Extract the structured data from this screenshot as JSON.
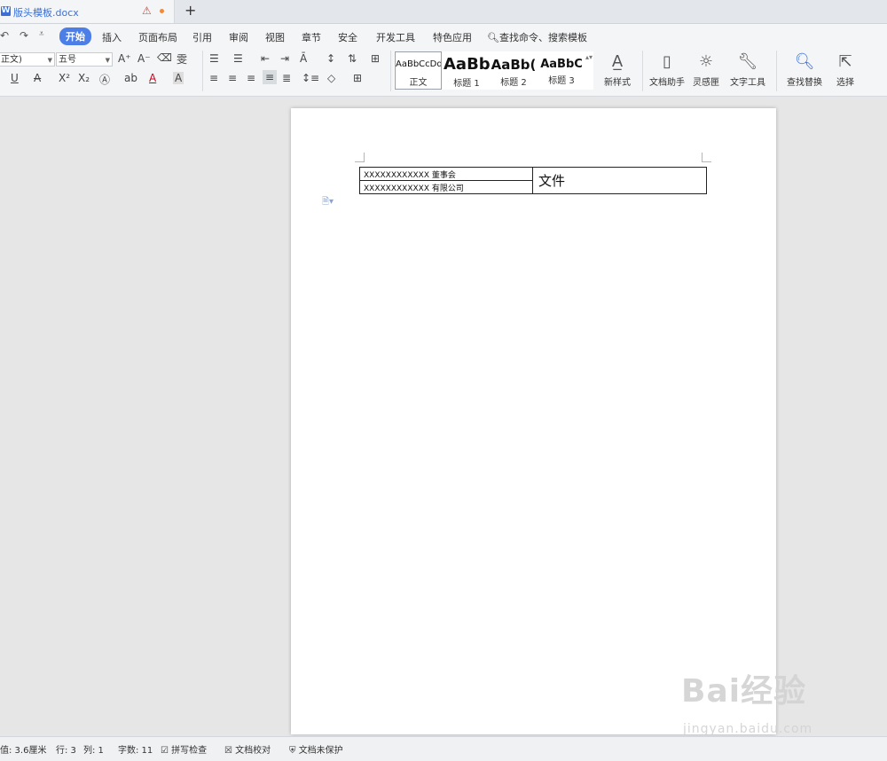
{
  "tab": {
    "title": "版头模板.docx",
    "icon_letter": "W",
    "add_symbol": "+"
  },
  "quick_access": {
    "undo": "↶",
    "redo": "↷",
    "customize": "⩡"
  },
  "menu": {
    "items": [
      "开始",
      "插入",
      "页面布局",
      "引用",
      "审阅",
      "视图",
      "章节",
      "安全",
      "开发工具",
      "特色应用"
    ],
    "search_placeholder": "查找命令、搜索模板"
  },
  "ribbon": {
    "style_combo": "正文)",
    "size_combo": "五号",
    "styles": [
      {
        "preview": "AaBbCcDd",
        "label": "正文"
      },
      {
        "preview": "AaBb",
        "label": "标题 1"
      },
      {
        "preview": "AaBb(",
        "label": "标题 2"
      },
      {
        "preview": "AaBbC",
        "label": "标题 3"
      }
    ],
    "new_style": "新样式",
    "doc_helper": "文档助手",
    "inspiration": "灵感匣",
    "text_tools": "文字工具",
    "find_replace": "查找替换",
    "select": "选择"
  },
  "document": {
    "table": {
      "row1_left": "XXXXXXXXXXXX 董事会",
      "row2_left": "XXXXXXXXXXXX 有限公司",
      "right": "文件"
    }
  },
  "status": {
    "setting": "值: 3.6厘米",
    "row": "行: 3",
    "col": "列: 1",
    "word_count": "字数: 11",
    "spell_check": "拼写检查",
    "doc_proof": "文档校对",
    "protect": "文档未保护"
  },
  "watermark": {
    "main": "Bai经验",
    "sub": "jingyan.baidu.com"
  },
  "colors": {
    "accent": "#4c7ee8",
    "tab_title": "#3b6fd6",
    "warning": "#e0402e"
  }
}
